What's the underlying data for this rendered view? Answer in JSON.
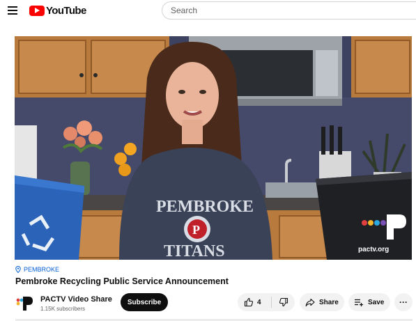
{
  "header": {
    "logo_text": "YouTube",
    "search_placeholder": "Search"
  },
  "video": {
    "overlay_logo_text": "pactv.org",
    "shirt_text_top": "PEMBROKE",
    "shirt_text_bottom": "TITANS",
    "shirt_emblem": "P"
  },
  "info": {
    "location": "PEMBROKE",
    "title": "Pembroke Recycling Public Service Announcement"
  },
  "channel": {
    "name": "PACTV Video Share",
    "subscribers": "1.15K subscribers",
    "subscribe_label": "Subscribe"
  },
  "actions": {
    "like_count": "4",
    "share_label": "Share",
    "save_label": "Save",
    "more_label": "···"
  },
  "colors": {
    "brand_red": "#ff0000",
    "link_blue": "#065fd4",
    "subscribe_bg": "#0f0f0f",
    "pill_bg": "#f2f2f2"
  }
}
